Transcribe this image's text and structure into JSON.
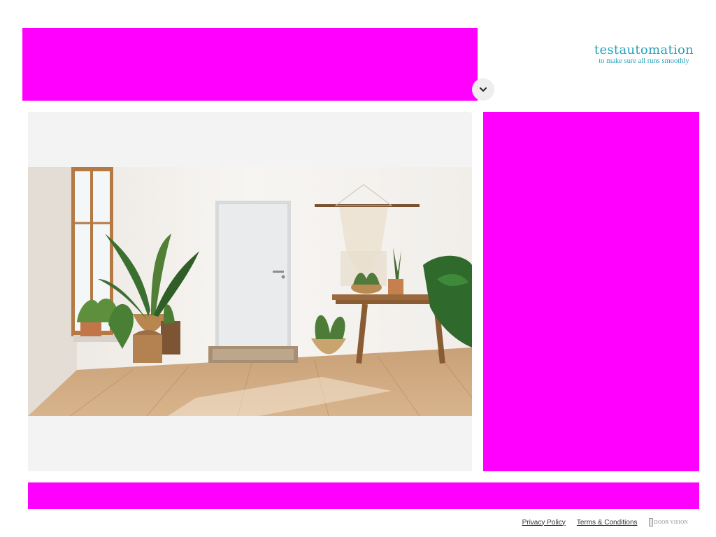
{
  "header": {
    "brand_name": "testautomation",
    "brand_tagline": "to make sure all runs smoothly"
  },
  "footer": {
    "privacy_label": "Privacy Policy",
    "terms_label": "Terms & Conditions",
    "logo_text": "DOOR VISION"
  },
  "icons": {
    "dropdown": "chevron-down-icon",
    "footer_logo": "door-vision-logo"
  },
  "colors": {
    "brand": "#2aa0b8",
    "placeholder": "#ff00ff",
    "panel_background": "#f3f3f3"
  }
}
